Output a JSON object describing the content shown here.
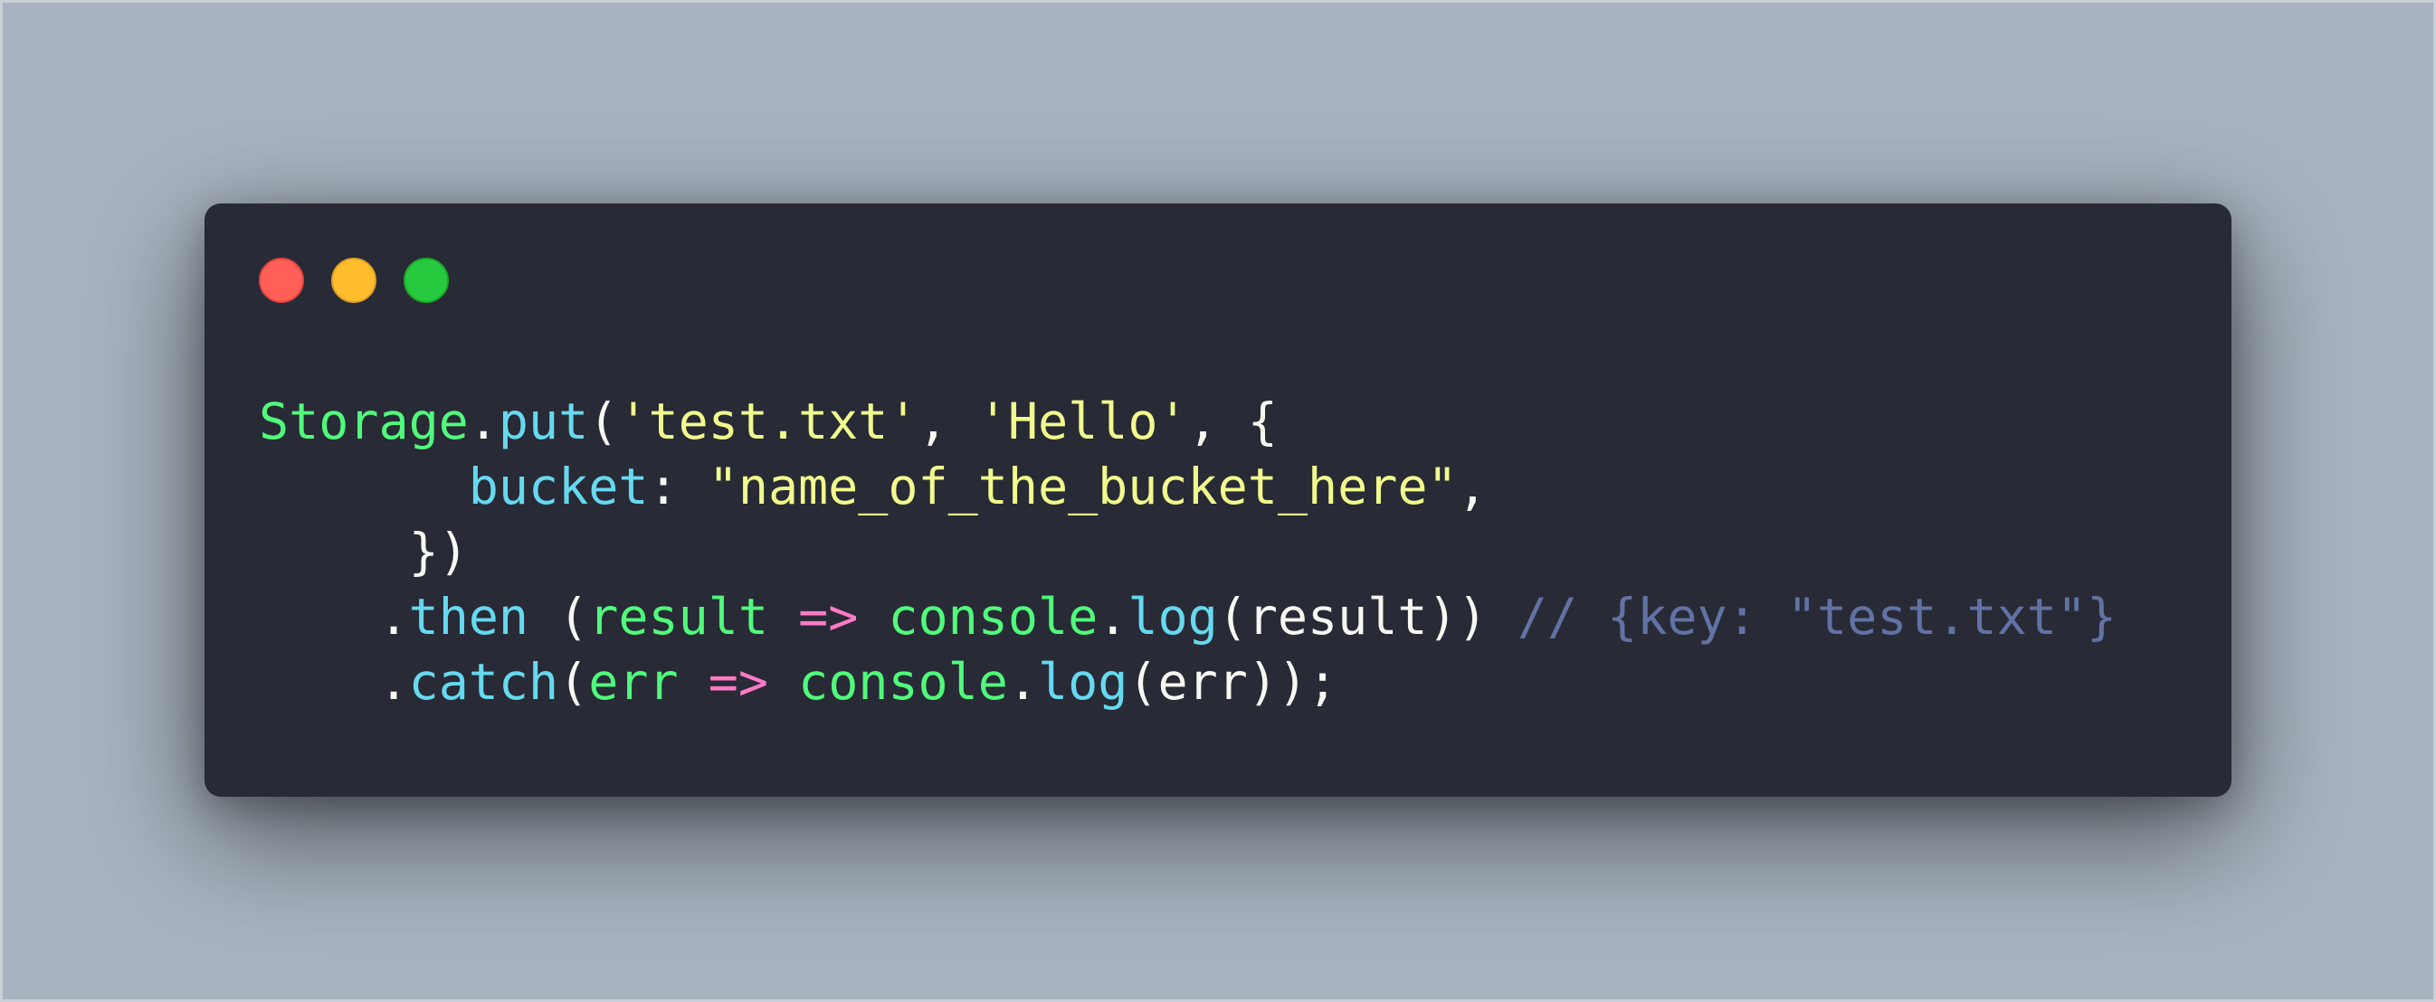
{
  "window": {
    "traffic_lights": [
      {
        "name": "close",
        "color": "#ff5f56"
      },
      {
        "name": "minimize",
        "color": "#ffbd2e"
      },
      {
        "name": "maximize",
        "color": "#27c93f"
      }
    ],
    "background": "#282a36"
  },
  "page": {
    "background": "#a8b3bf"
  },
  "code": {
    "language": "javascript",
    "lines": [
      [
        {
          "t": "Storage",
          "c": "cls"
        },
        {
          "t": ".",
          "c": "pl"
        },
        {
          "t": "put",
          "c": "fn"
        },
        {
          "t": "(",
          "c": "pl"
        },
        {
          "t": "'test.txt'",
          "c": "str"
        },
        {
          "t": ", ",
          "c": "pl"
        },
        {
          "t": "'Hello'",
          "c": "str"
        },
        {
          "t": ", {",
          "c": "pl"
        }
      ],
      [
        {
          "t": "       ",
          "c": "pl"
        },
        {
          "t": "bucket",
          "c": "prop"
        },
        {
          "t": ": ",
          "c": "pl"
        },
        {
          "t": "\"name_of_the_bucket_here\"",
          "c": "str"
        },
        {
          "t": ",",
          "c": "pl"
        }
      ],
      [
        {
          "t": "     })",
          "c": "pl"
        }
      ],
      [
        {
          "t": "    .",
          "c": "pl"
        },
        {
          "t": "then",
          "c": "fn"
        },
        {
          "t": " (",
          "c": "pl"
        },
        {
          "t": "result",
          "c": "cls"
        },
        {
          "t": " ",
          "c": "pl"
        },
        {
          "t": "=>",
          "c": "op"
        },
        {
          "t": " ",
          "c": "pl"
        },
        {
          "t": "console",
          "c": "cls"
        },
        {
          "t": ".",
          "c": "pl"
        },
        {
          "t": "log",
          "c": "fn"
        },
        {
          "t": "(result)) ",
          "c": "pl"
        },
        {
          "t": "// {key: \"test.txt\"}",
          "c": "cm"
        }
      ],
      [
        {
          "t": "    .",
          "c": "pl"
        },
        {
          "t": "catch",
          "c": "fn"
        },
        {
          "t": "(",
          "c": "pl"
        },
        {
          "t": "err",
          "c": "cls"
        },
        {
          "t": " ",
          "c": "pl"
        },
        {
          "t": "=>",
          "c": "op"
        },
        {
          "t": " ",
          "c": "pl"
        },
        {
          "t": "console",
          "c": "cls"
        },
        {
          "t": ".",
          "c": "pl"
        },
        {
          "t": "log",
          "c": "fn"
        },
        {
          "t": "(err));",
          "c": "pl"
        }
      ]
    ]
  }
}
